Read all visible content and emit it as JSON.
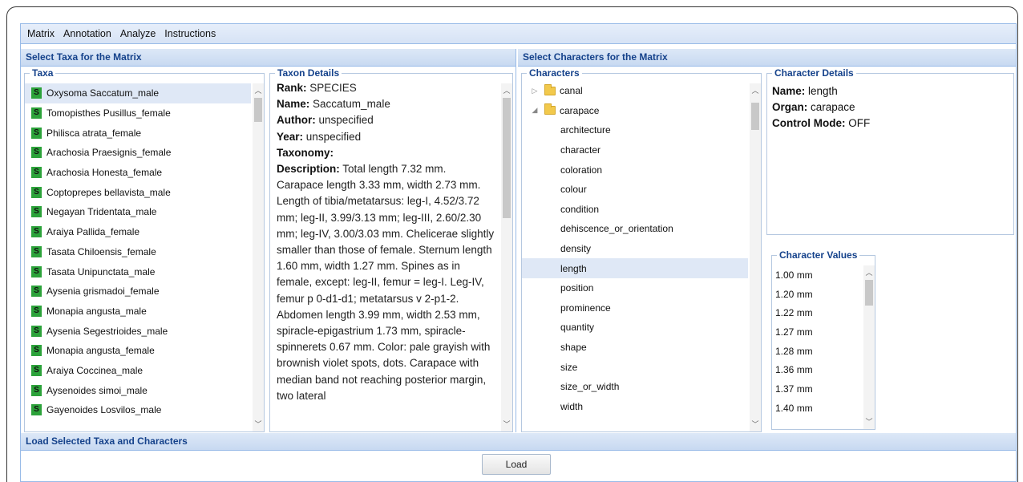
{
  "menu": [
    "Matrix",
    "Annotation",
    "Analyze",
    "Instructions"
  ],
  "left_panel": {
    "title": "Select Taxa for the Matrix",
    "taxa_legend": "Taxa",
    "details_legend": "Taxon Details",
    "taxa": [
      {
        "badge": "S",
        "name": "Oxysoma Saccatum_male"
      },
      {
        "badge": "S",
        "name": "Tomopisthes Pusillus_female"
      },
      {
        "badge": "S",
        "name": "Philisca atrata_female"
      },
      {
        "badge": "S",
        "name": "Arachosia Praesignis_female"
      },
      {
        "badge": "S",
        "name": "Arachosia Honesta_female"
      },
      {
        "badge": "S",
        "name": "Coptoprepes bellavista_male"
      },
      {
        "badge": "S",
        "name": "Negayan Tridentata_male"
      },
      {
        "badge": "S",
        "name": "Araiya Pallida_female"
      },
      {
        "badge": "S",
        "name": "Tasata Chiloensis_female"
      },
      {
        "badge": "S",
        "name": "Tasata Unipunctata_male"
      },
      {
        "badge": "S",
        "name": "Aysenia grismadoi_female"
      },
      {
        "badge": "S",
        "name": "Monapia angusta_male"
      },
      {
        "badge": "S",
        "name": "Aysenia Segestrioides_male"
      },
      {
        "badge": "S",
        "name": "Monapia angusta_female"
      },
      {
        "badge": "S",
        "name": "Araiya Coccinea_male"
      },
      {
        "badge": "S",
        "name": "Aysenoides simoi_male"
      },
      {
        "badge": "S",
        "name": "Gayenoides Losvilos_male"
      }
    ],
    "details": {
      "rank_label": "Rank:",
      "rank": "SPECIES",
      "name_label": "Name:",
      "name": "Saccatum_male",
      "author_label": "Author:",
      "author": "unspecified",
      "year_label": "Year:",
      "year": "unspecified",
      "taxonomy_label": "Taxonomy:",
      "description_label": "Description:",
      "description": "Total length 7.32 mm. Carapace length 3.33 mm, width 2.73 mm. Length of tibia/metatarsus: leg-I, 4.52/3.72 mm; leg-II, 3.99/3.13 mm; leg-III, 2.60/2.30 mm; leg-IV, 3.00/3.03 mm. Chelicerae slightly smaller than those of female. Sternum length 1.60 mm, width 1.27 mm. Spines as in female, except: leg-II, femur = leg-I. Leg-IV, femur p 0-d1-d1; metatarsus v 2-p1-2. Abdomen length 3.99 mm, width 2.53 mm, spiracle-epigastrium 1.73 mm, spiracle-spinnerets 0.67 mm. Color: pale grayish with brownish violet spots, dots. Carapace with median band not reaching posterior margin, two lateral"
    }
  },
  "right_panel": {
    "title": "Select Characters for the Matrix",
    "characters_legend": "Characters",
    "details_legend": "Character Details",
    "values_legend": "Character Values",
    "tree": [
      {
        "label": "canal",
        "level": 0,
        "expanded": false
      },
      {
        "label": "carapace",
        "level": 0,
        "expanded": true
      },
      {
        "label": "architecture",
        "level": 1
      },
      {
        "label": "character",
        "level": 1
      },
      {
        "label": "coloration",
        "level": 1
      },
      {
        "label": "colour",
        "level": 1
      },
      {
        "label": "condition",
        "level": 1
      },
      {
        "label": "dehiscence_or_orientation",
        "level": 1
      },
      {
        "label": "density",
        "level": 1
      },
      {
        "label": "length",
        "level": 1
      },
      {
        "label": "position",
        "level": 1
      },
      {
        "label": "prominence",
        "level": 1
      },
      {
        "label": "quantity",
        "level": 1
      },
      {
        "label": "shape",
        "level": 1
      },
      {
        "label": "size",
        "level": 1
      },
      {
        "label": "size_or_width",
        "level": 1
      },
      {
        "label": "width",
        "level": 1
      }
    ],
    "char_details": {
      "name_label": "Name:",
      "name": "length",
      "organ_label": "Organ:",
      "organ": "carapace",
      "control_label": "Control Mode:",
      "control": "OFF"
    },
    "values": [
      "1.00 mm",
      "1.20 mm",
      "1.22 mm",
      "1.27 mm",
      "1.28 mm",
      "1.36 mm",
      "1.37 mm",
      "1.40 mm"
    ]
  },
  "bottom": {
    "title": "Load Selected Taxa and Characters",
    "load_label": "Load"
  },
  "colors": {
    "header_text": "#15428b",
    "badge": "#2ca23a",
    "selection": "#dfe8f6",
    "border": "#99bbe8"
  }
}
